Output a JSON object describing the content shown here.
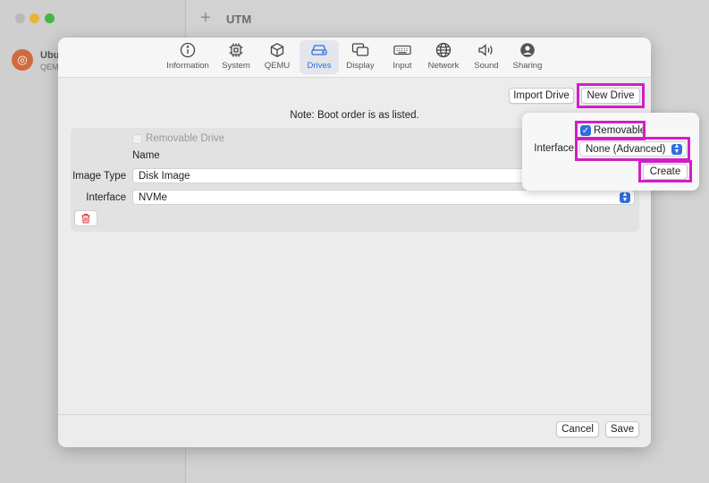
{
  "app": {
    "title": "UTM"
  },
  "sidebar": {
    "vm_name": "Ubu",
    "vm_sub": "QEM"
  },
  "tabs": [
    {
      "label": "Information",
      "icon": "info-icon"
    },
    {
      "label": "System",
      "icon": "cpu-icon"
    },
    {
      "label": "QEMU",
      "icon": "cube-icon"
    },
    {
      "label": "Drives",
      "icon": "drive-icon",
      "active": true
    },
    {
      "label": "Display",
      "icon": "display-icon"
    },
    {
      "label": "Input",
      "icon": "keyboard-icon"
    },
    {
      "label": "Network",
      "icon": "globe-icon"
    },
    {
      "label": "Sound",
      "icon": "speaker-icon"
    },
    {
      "label": "Sharing",
      "icon": "person-icon"
    }
  ],
  "drives": {
    "import_label": "Import Drive",
    "new_label": "New Drive",
    "note": "Note: Boot order is as listed.",
    "removable_label": "Removable Drive",
    "name_label": "Name",
    "image_type_label": "Image Type",
    "image_type_value": "Disk Image",
    "interface_label": "Interface",
    "interface_value": "NVMe"
  },
  "popover": {
    "removable_label": "Removable",
    "removable_checked": true,
    "interface_label": "Interface",
    "interface_value": "None (Advanced)",
    "create_label": "Create"
  },
  "footer": {
    "cancel_label": "Cancel",
    "save_label": "Save"
  },
  "colors": {
    "accent": "#2f6fe0",
    "highlight": "#d21ec8",
    "delete": "#dd3333"
  }
}
